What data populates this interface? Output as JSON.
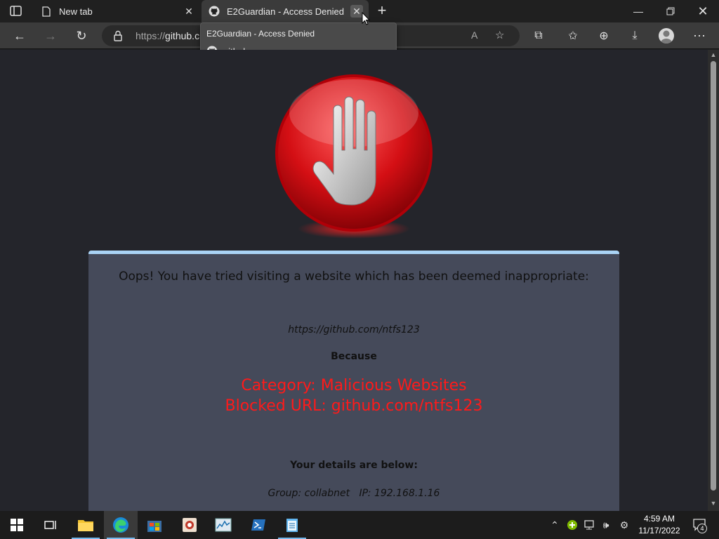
{
  "browser": {
    "tabs": [
      {
        "label": "New tab",
        "icon": "page-icon"
      },
      {
        "label": "E2Guardian - Access Denied",
        "icon": "github-icon"
      }
    ],
    "address_scheme": "https://",
    "address_host": "github.c",
    "hover_card": {
      "title": "E2Guardian - Access Denied",
      "domain": "github.com"
    }
  },
  "page": {
    "headline": "Oops! You have tried visiting a website which has been deemed inappropriate:",
    "blocked_url": "https://github.com/ntfs123",
    "because": "Because",
    "reason_category": "Category: Malicious Websites",
    "reason_blocked": "Blocked URL: github.com/ntfs123",
    "details_heading": "Your details are below:",
    "details_line": "Group: collabnet   IP: 192.168.1.16",
    "colors": {
      "background": "#24252b",
      "panel": "#454a5a",
      "panel_border": "#a9d3f5",
      "reason": "#ff1a1a"
    }
  },
  "taskbar": {
    "time": "4:59 AM",
    "date": "11/17/2022",
    "notification_count": "4",
    "apps": [
      "start-icon",
      "task-view-icon",
      "file-explorer-icon",
      "edge-icon",
      "store-icon",
      "app-icon",
      "resource-monitor-icon",
      "powershell-icon",
      "notepad-icon"
    ]
  }
}
